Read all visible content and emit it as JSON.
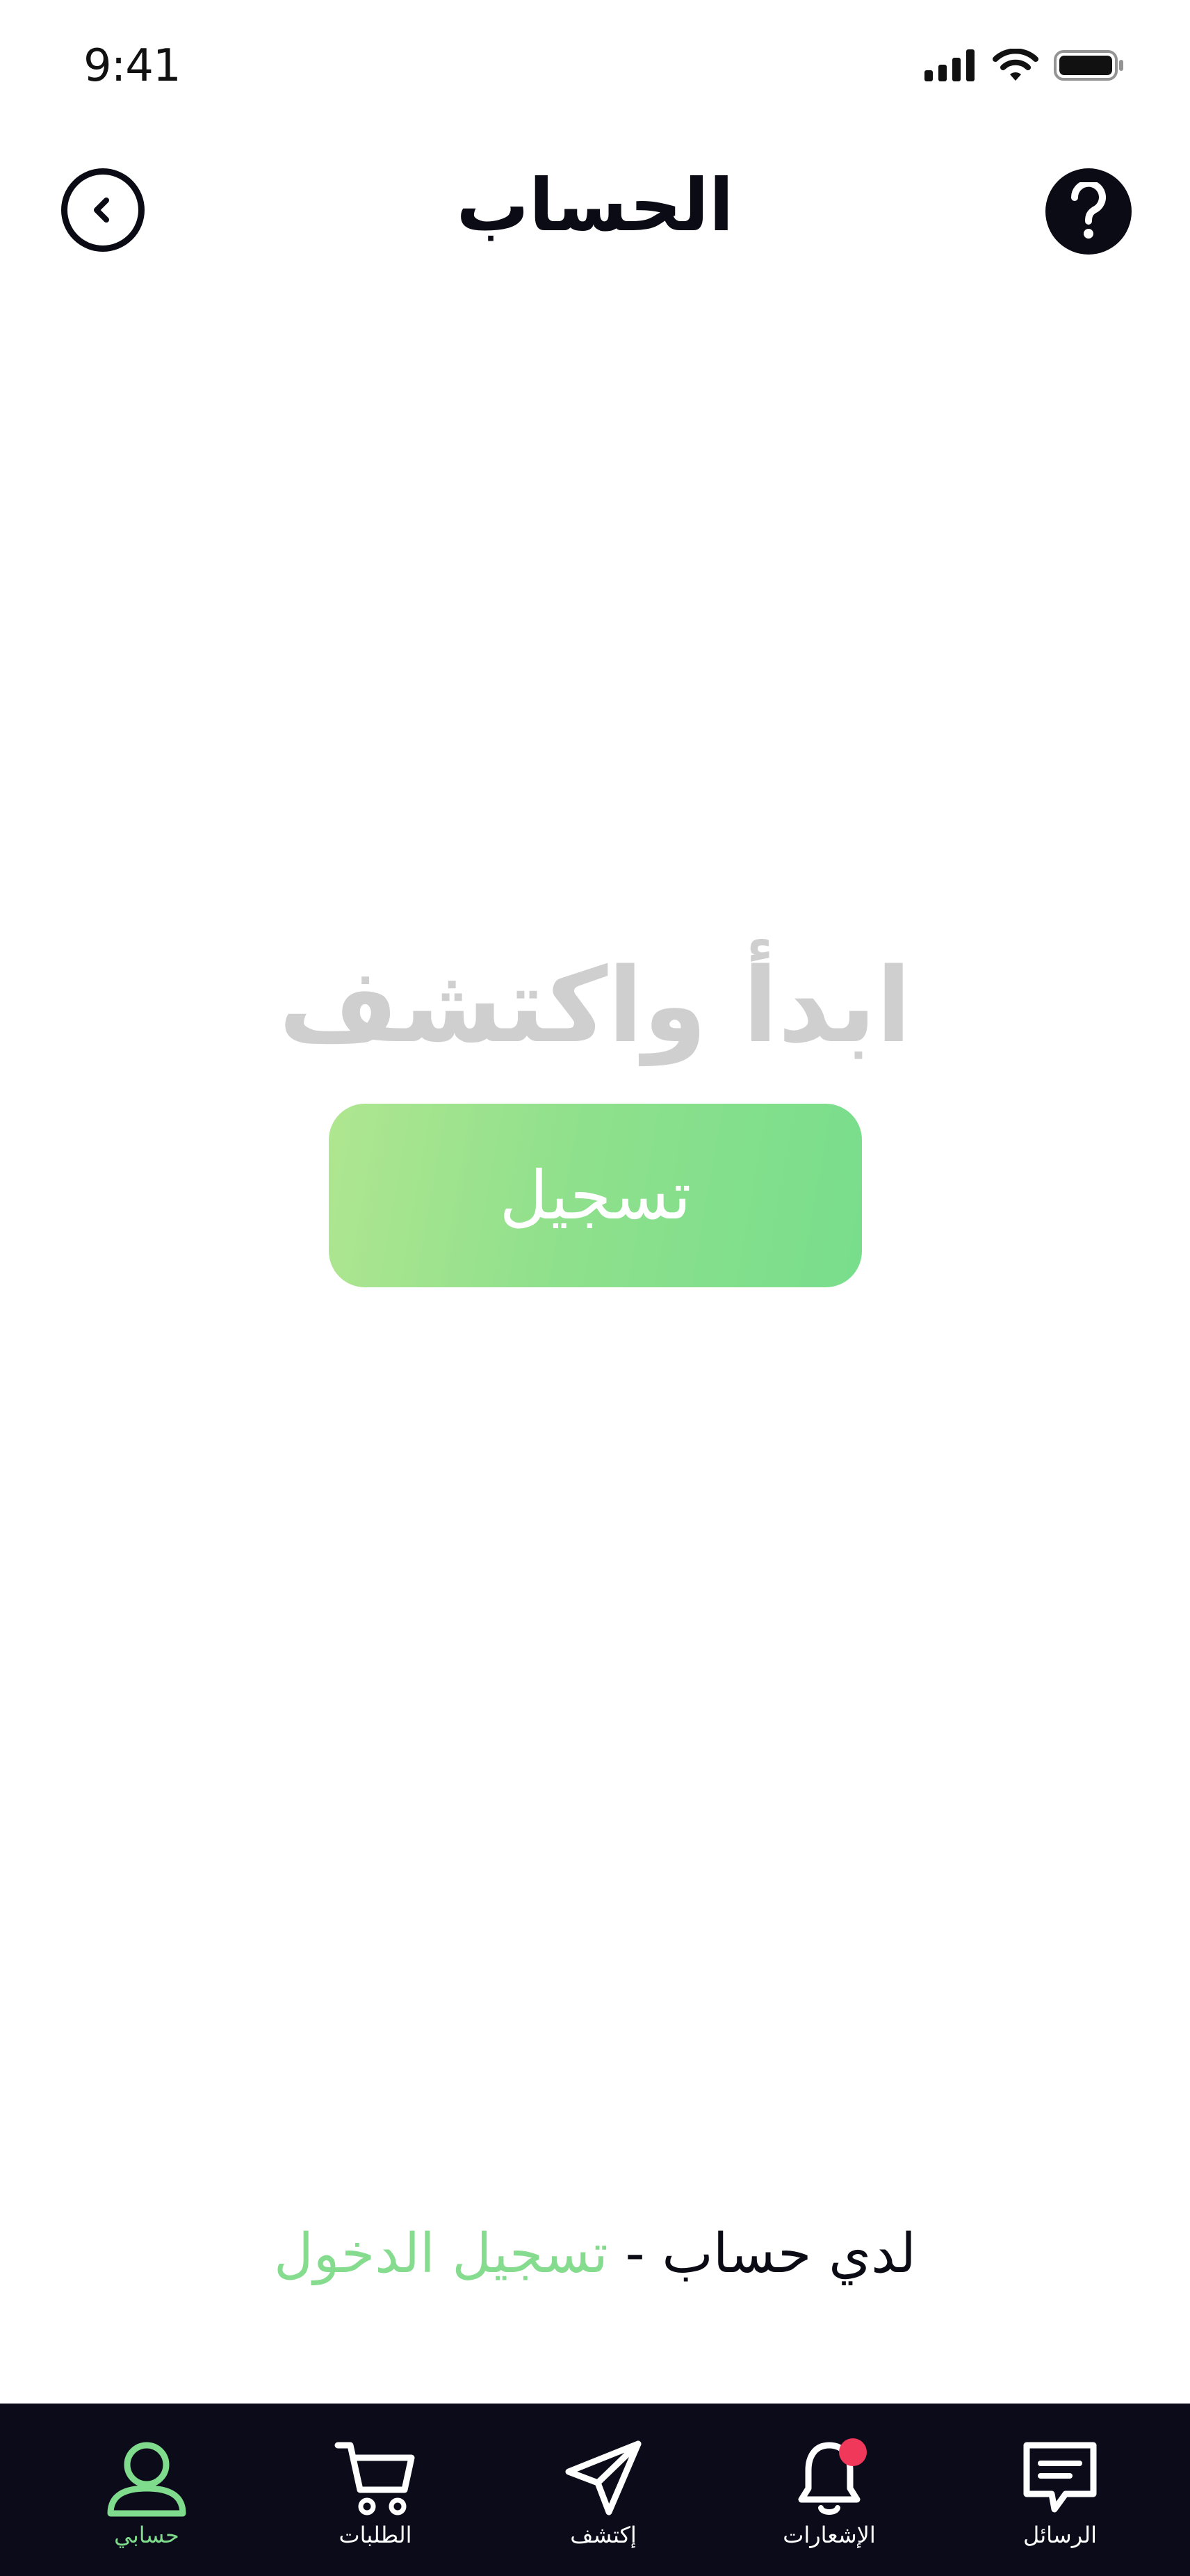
{
  "status_bar": {
    "time": "9:41",
    "icons": [
      "signal-icon",
      "wifi-icon",
      "battery-icon"
    ]
  },
  "header": {
    "title": "الحساب",
    "back_icon": "chevron-left-icon",
    "help_icon": "question-mark-icon"
  },
  "main": {
    "headline": "ابدأ واكتشف",
    "register_label": "تسجيل",
    "login_prompt": "لدي حساب -",
    "login_link": "تسجيل الدخول"
  },
  "bottom_nav": {
    "items": [
      {
        "label": "حسابي",
        "icon": "user-icon",
        "active": true
      },
      {
        "label": "الطلبات",
        "icon": "cart-icon",
        "active": false
      },
      {
        "label": "إكتشف",
        "icon": "send-icon",
        "active": false
      },
      {
        "label": "الإشعارات",
        "icon": "bell-icon",
        "active": false,
        "badge": true
      },
      {
        "label": "الرسائل",
        "icon": "message-icon",
        "active": false
      }
    ]
  },
  "colors": {
    "accent_green": "#7fdc8c",
    "nav_background": "#0b0b1a",
    "badge_red": "#f0385a",
    "headline_gray": "#cfcfcf"
  }
}
